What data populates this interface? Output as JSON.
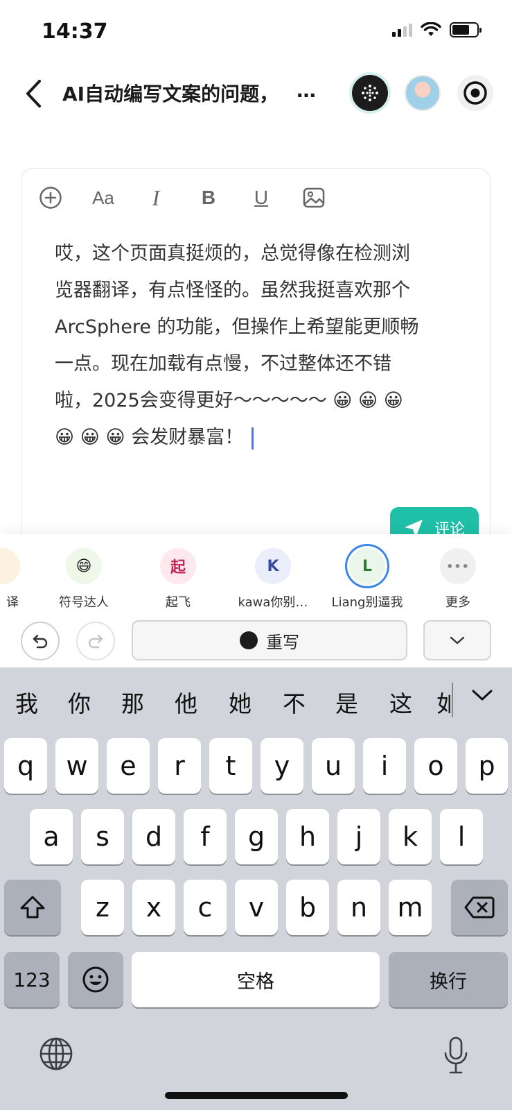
{
  "status_bar": {
    "time": "14:37",
    "battery_level": 0.72,
    "icons": [
      "signal-icon",
      "wifi-icon",
      "battery-icon"
    ]
  },
  "header": {
    "title": "AI自动编写文案的问题，",
    "ellipsis": "…",
    "icons": [
      "back-icon",
      "ai-assistant-icon",
      "avatar",
      "record-icon"
    ]
  },
  "toolbar": {
    "items": [
      "plus-icon",
      "text-size-icon",
      "italic-icon",
      "bold-icon",
      "underline-icon",
      "image-icon"
    ],
    "text_size_label": "Aa",
    "italic_label": "I",
    "bold_label": "B",
    "underline_label": "U"
  },
  "editor": {
    "line1": "哎，这个页面真挺烦的，总觉得像在检测浏",
    "line2": "览器翻译，有点怪怪的。虽然我挺喜欢那个",
    "line3": "ArcSphere 的功能，但操作上希望能更顺畅",
    "line4": "一点。现在加载有点慢，不过整体还不错",
    "line5": "啦，2025会变得更好～～～～～ 😀 😀 😀",
    "line6": "😀 😀 😀 会发财暴富！"
  },
  "comment_button": {
    "label": "评论"
  },
  "personas": [
    {
      "label": "译",
      "avatar_text": ""
    },
    {
      "label": "符号达人",
      "avatar_text": "😄",
      "color": "#eef7e8"
    },
    {
      "label": "起飞",
      "avatar_text": "起",
      "color": "#fde8ee",
      "text_color": "#c0285a"
    },
    {
      "label": "kawa你别…",
      "avatar_text": "K",
      "color": "#eaeefb",
      "text_color": "#3b4aa0"
    },
    {
      "label": "Liang别逼我",
      "avatar_text": "L",
      "color": "#eaf6ea",
      "text_color": "#2f7a35"
    },
    {
      "label": "更多",
      "avatar_text": "•••",
      "color": "#f0f0f0",
      "text_color": "#888888"
    }
  ],
  "controls": {
    "undo_icon": "undo-icon",
    "redo_icon": "redo-icon",
    "rewrite_label": "重写",
    "dropdown_icon": "chevron-down-icon"
  },
  "keyboard": {
    "candidates": [
      "我",
      "你",
      "那",
      "他",
      "她",
      "不",
      "是",
      "这",
      "如"
    ],
    "row1": [
      "q",
      "w",
      "e",
      "r",
      "t",
      "y",
      "u",
      "i",
      "o",
      "p"
    ],
    "row2": [
      "a",
      "s",
      "d",
      "f",
      "g",
      "h",
      "j",
      "k",
      "l"
    ],
    "row3": [
      "z",
      "x",
      "c",
      "v",
      "b",
      "n",
      "m"
    ],
    "numbers_label": "123",
    "space_label": "空格",
    "return_label": "换行",
    "icons": [
      "shift-icon",
      "backspace-icon",
      "emoji-icon",
      "globe-icon",
      "microphone-icon"
    ]
  },
  "colors": {
    "accent": "#1fbfa8",
    "active_ring": "#3a87e8",
    "caret": "#3a7bff",
    "keyboard_bg": "#d1d4da"
  }
}
